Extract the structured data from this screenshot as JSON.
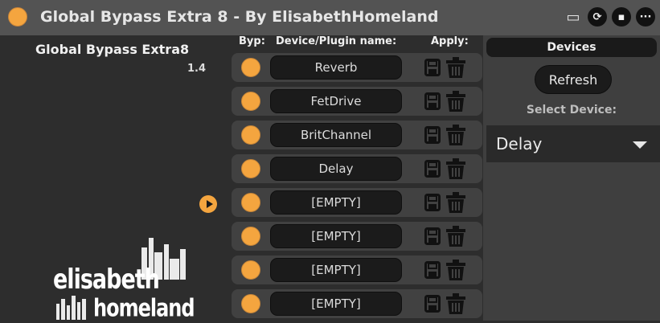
{
  "window": {
    "title": "Global Bypass Extra 8 - By ElisabethHomeland"
  },
  "titlebar_icons": [
    {
      "name": "pin-icon",
      "glyph": "▭"
    },
    {
      "name": "refresh-icon",
      "glyph": "⟳"
    },
    {
      "name": "save-icon",
      "glyph": "▪"
    },
    {
      "name": "more-icon",
      "glyph": "···"
    }
  ],
  "left": {
    "app_name": "Global Bypass Extra8",
    "version": "1.4"
  },
  "logo": {
    "line1": "elisabeth",
    "line2": "homeland"
  },
  "list": {
    "headers": {
      "byp": "Byp:",
      "name": "Device/Plugin name:",
      "apply": "Apply:"
    },
    "rows": [
      {
        "name": "Reverb"
      },
      {
        "name": "FetDrive"
      },
      {
        "name": "BritChannel"
      },
      {
        "name": "Delay"
      },
      {
        "name": "[EMPTY]"
      },
      {
        "name": "[EMPTY]"
      },
      {
        "name": "[EMPTY]"
      },
      {
        "name": "[EMPTY]"
      }
    ]
  },
  "devices": {
    "header": "Devices",
    "refresh_label": "Refresh",
    "select_label": "Select Device:",
    "selected": "Delay"
  },
  "colors": {
    "accent": "#f4a53f",
    "panel": "#3f3f3f",
    "field": "#1b1b1b"
  }
}
